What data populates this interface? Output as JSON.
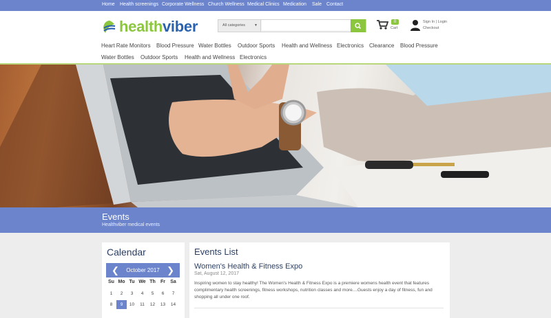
{
  "topnav": [
    "Home",
    "Health screenings",
    "Corporate Wellness",
    "Church Wellness",
    "Medical Clinics",
    "Medication",
    "Sale",
    "Contact"
  ],
  "logo": {
    "part1": "health",
    "part2": "viber"
  },
  "search": {
    "category": "All categories",
    "placeholder": ""
  },
  "cart": {
    "count": "0",
    "label": "Cart"
  },
  "user": {
    "line1": "Sign In | Login",
    "line2": "Checkout"
  },
  "nav_row1": [
    "Heart Rate Monitors",
    "Blood Pressure",
    "Water Bottles",
    "Outdoor Sports",
    "Health and Wellness",
    "Electronics",
    "Clearance",
    "Blood Pressure"
  ],
  "nav_row2": [
    "Water Bottles",
    "Outdoor Sports",
    "Health and Wellness",
    "Electronics"
  ],
  "band": {
    "title": "Events",
    "subtitle": "Healthviber medical events"
  },
  "calendar": {
    "heading": "Calendar",
    "month": "October 2017",
    "weekdays": [
      "Su",
      "Mo",
      "Tu",
      "We",
      "Th",
      "Fr",
      "Sa"
    ],
    "days": [
      "1",
      "2",
      "3",
      "4",
      "5",
      "6",
      "7",
      "8",
      "9",
      "10",
      "11",
      "12",
      "13",
      "14"
    ],
    "selected": "9"
  },
  "events": {
    "heading": "Events List",
    "items": [
      {
        "title": "Women's Health & Fitness Expo",
        "date": "Sat, August 12, 2017",
        "desc": "Inspiring women to stay healthy! The Women's Health & Fitness Expo is a premiere womens health event that features complimentary health screenings, fitness workshops, nutrition classes and more....Guests enjoy a day of fitness, fun and shopping all under one roof."
      }
    ]
  },
  "colors": {
    "accent": "#6b84cc",
    "brand_green": "#8cc63f",
    "brand_blue": "#2a62ad"
  }
}
